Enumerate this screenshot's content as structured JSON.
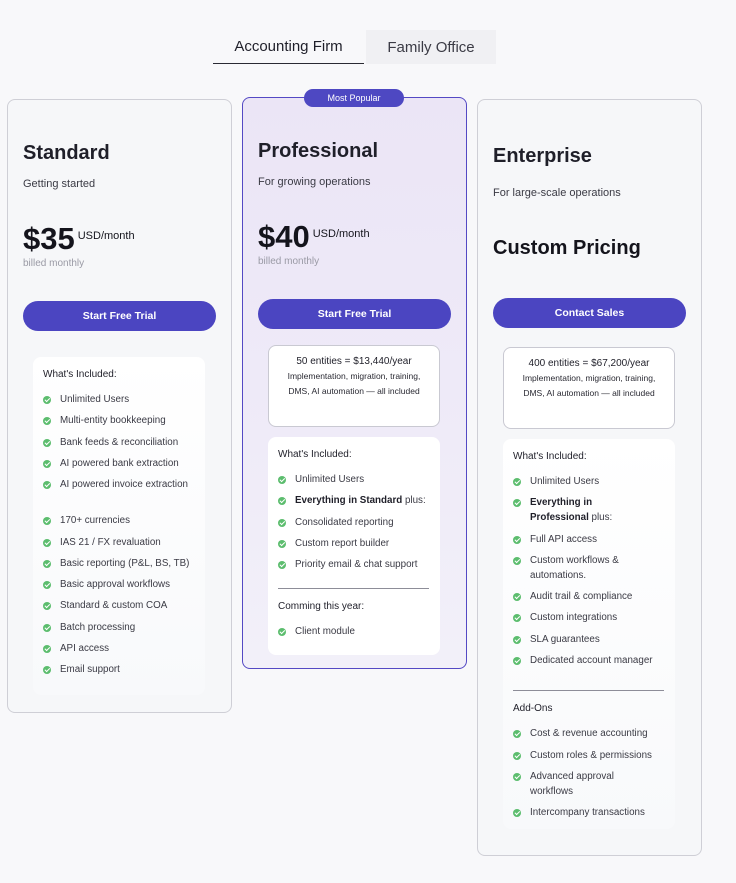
{
  "tabs": [
    {
      "label": "Accounting Firm",
      "active": true
    },
    {
      "label": "Family Office",
      "active": false
    }
  ],
  "colors": {
    "accent": "#4b45c1",
    "check": "#5cbd6e",
    "popular_bg": "#ebe5f6"
  },
  "plans": {
    "standard": {
      "name": "Standard",
      "subtitle": "Getting started",
      "price": "$35",
      "unit": "USD/month",
      "billing": "billed monthly",
      "cta": "Start Free Trial",
      "included_heading": "What's Included:",
      "features": [
        "Unlimited Users",
        "Multi-entity bookkeeping",
        "Bank feeds & reconciliation",
        "AI powered bank extraction",
        "AI powered invoice extraction",
        "170+ currencies",
        "IAS 21 / FX revaluation",
        "Basic reporting (P&L, BS, TB)",
        "Basic approval workflows",
        "Standard & custom COA",
        "Batch processing",
        "API access",
        "Email support"
      ]
    },
    "professional": {
      "badge": "Most Popular",
      "name": "Professional",
      "subtitle": "For growing operations",
      "price": "$40",
      "unit": "USD/month",
      "billing": "billed monthly",
      "cta": "Start Free Trial",
      "entity_head": "50 entities = $13,440/year",
      "entity_body": "Implementation, migration, training, DMS, AI automation — all included",
      "included_heading": "What's Included:",
      "features": [
        {
          "bold": "",
          "text": "Unlimited Users"
        },
        {
          "bold": "Everything in Standard",
          "text": " plus:"
        },
        {
          "bold": "",
          "text": "Consolidated reporting"
        },
        {
          "bold": "",
          "text": "Custom report builder"
        },
        {
          "bold": "",
          "text": "Priority email & chat support"
        }
      ],
      "coming_heading": "Comming this year:",
      "coming": [
        "Client module"
      ]
    },
    "enterprise": {
      "name": "Enterprise",
      "subtitle": "For large-scale operations",
      "price_text": "Custom Pricing",
      "cta": "Contact Sales",
      "entity_head": "400 entities = $67,200/year",
      "entity_body": "Implementation, migration, training, DMS, AI automation — all included",
      "included_heading": "What's Included:",
      "features": [
        {
          "bold": "",
          "text": "Unlimited Users"
        },
        {
          "bold": "Everything in Professional",
          "text": " plus:"
        },
        {
          "bold": "",
          "text": "Full API access"
        },
        {
          "bold": "",
          "text": "Custom workflows & automations."
        },
        {
          "bold": "",
          "text": "Audit trail & compliance"
        },
        {
          "bold": "",
          "text": "Custom integrations"
        },
        {
          "bold": "",
          "text": "SLA guarantees"
        },
        {
          "bold": "",
          "text": "Dedicated account manager"
        }
      ],
      "addons_heading": "Add-Ons",
      "addons": [
        "Cost & revenue accounting",
        "Custom roles & permissions",
        "Advanced approval workflows",
        "Intercompany transactions"
      ]
    }
  }
}
